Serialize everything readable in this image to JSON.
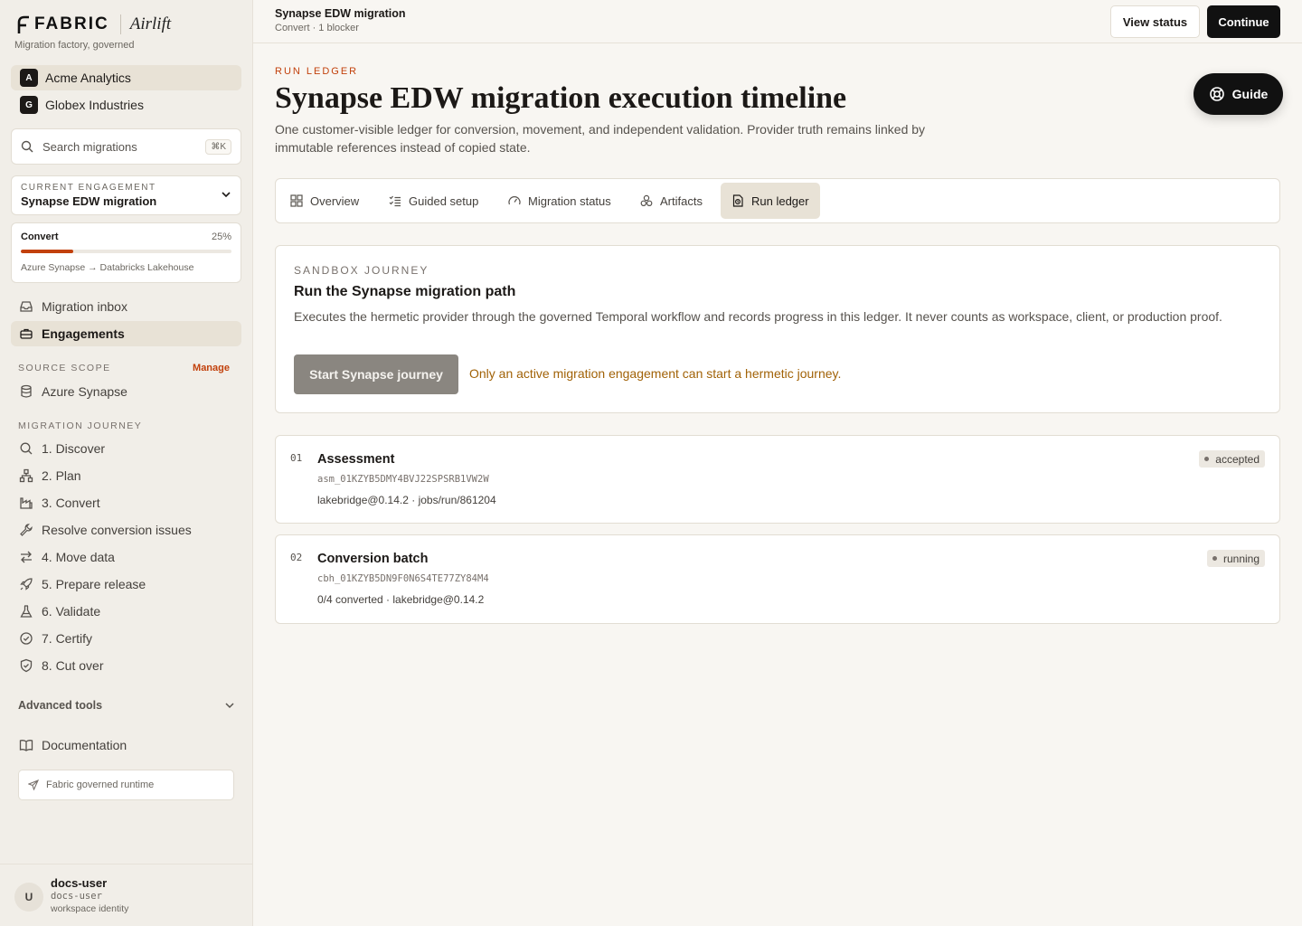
{
  "brand": {
    "name": "FABRIC",
    "product": "Airlift",
    "tagline": "Migration factory, governed"
  },
  "tenants": [
    {
      "badge": "A",
      "name": "Acme Analytics",
      "active": true
    },
    {
      "badge": "G",
      "name": "Globex Industries",
      "active": false
    }
  ],
  "search": {
    "placeholder": "Search migrations",
    "shortcut": "⌘K"
  },
  "engagement": {
    "label": "CURRENT ENGAGEMENT",
    "value": "Synapse EDW migration"
  },
  "progress": {
    "phase": "Convert",
    "percent_label": "25%",
    "percent": 25,
    "route": "Azure Synapse → Databricks Lakehouse"
  },
  "nav": {
    "inbox": "Migration inbox",
    "engagements": "Engagements",
    "source_scope_label": "SOURCE SCOPE",
    "manage": "Manage",
    "source": "Azure Synapse",
    "journey_label": "MIGRATION JOURNEY",
    "journey": [
      "1. Discover",
      "2. Plan",
      "3. Convert",
      "Resolve conversion issues",
      "4. Move data",
      "5. Prepare release",
      "6. Validate",
      "7. Certify",
      "8. Cut over"
    ],
    "advanced": "Advanced tools",
    "docs": "Documentation",
    "runtime": "Fabric governed runtime"
  },
  "user": {
    "avatar": "U",
    "name": "docs-user",
    "id": "docs-user",
    "role": "workspace identity"
  },
  "topbar": {
    "title": "Synapse EDW migration",
    "subtitle": "Convert · 1 blocker",
    "view_status": "View status",
    "continue": "Continue"
  },
  "page": {
    "eyebrow": "RUN LEDGER",
    "title": "Synapse EDW migration execution timeline",
    "description": "One customer-visible ledger for conversion, movement, and independent validation. Provider truth remains linked by immutable references instead of copied state.",
    "guide": "Guide"
  },
  "tabs": [
    "Overview",
    "Guided setup",
    "Migration status",
    "Artifacts",
    "Run ledger"
  ],
  "sandbox": {
    "label": "SANDBOX JOURNEY",
    "title": "Run the Synapse migration path",
    "description": "Executes the hermetic provider through the governed Temporal workflow and records progress in this ledger. It never counts as workspace, client, or production proof.",
    "button": "Start Synapse journey",
    "note": "Only an active migration engagement can start a hermetic journey."
  },
  "ledger": [
    {
      "index": "01",
      "title": "Assessment",
      "id": "asm_01KZYB5DMY4BVJ22SPSRB1VW2W",
      "meta": "lakebridge@0.14.2 · jobs/run/861204",
      "status": "accepted"
    },
    {
      "index": "02",
      "title": "Conversion batch",
      "id": "cbh_01KZYB5DN9F0N6S4TE77ZY84M4",
      "meta": "0/4 converted · lakebridge@0.14.2",
      "status": "running"
    }
  ],
  "colors": {
    "accent": "#c2410c",
    "warning_text": "#a16207",
    "primary_button": "#111111",
    "disabled_button": "#8a8680"
  }
}
